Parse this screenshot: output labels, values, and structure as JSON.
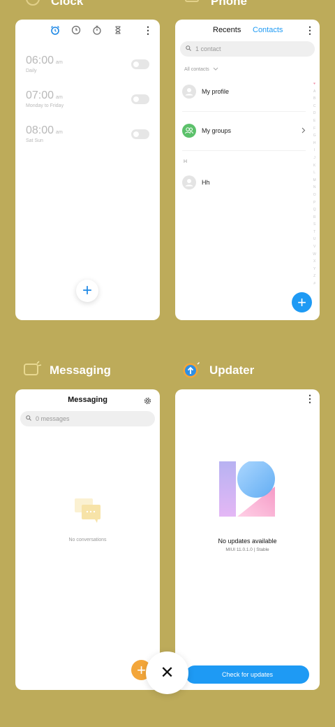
{
  "apps": {
    "clock": {
      "name": "Clock"
    },
    "phone": {
      "name": "Phone"
    },
    "messaging": {
      "name": "Messaging"
    },
    "updater": {
      "name": "Updater"
    }
  },
  "clock": {
    "alarms": [
      {
        "time": "06:00",
        "ampm": "am",
        "repeat": "Daily"
      },
      {
        "time": "07:00",
        "ampm": "am",
        "repeat": "Monday to Friday"
      },
      {
        "time": "08:00",
        "ampm": "am",
        "repeat": "Sat Sun"
      }
    ],
    "add": "+",
    "menu": "⋮",
    "accent": "#1e88e5"
  },
  "phone": {
    "tab_recents": "Recents",
    "tab_contacts": "Contacts",
    "menu": "⋮",
    "search_placeholder": "1 contact",
    "filter": "All contacts",
    "my_profile": "My profile",
    "my_groups": "My groups",
    "section_h": "H",
    "contact_hh": "Hh",
    "add": "+",
    "index_letters": [
      "♥",
      "A",
      "B",
      "C",
      "D",
      "E",
      "F",
      "G",
      "H",
      "I",
      "J",
      "K",
      "L",
      "M",
      "N",
      "O",
      "P",
      "Q",
      "R",
      "S",
      "T",
      "U",
      "V",
      "W",
      "X",
      "Y",
      "Z",
      "#"
    ]
  },
  "messaging": {
    "title": "Messaging",
    "search_placeholder": "0 messages",
    "empty": "No conversations",
    "add": "+"
  },
  "updater": {
    "menu": "⋮",
    "status": "No updates available",
    "version": "MIUI 11.0.1.0 | Stable",
    "check_button": "Check for updates"
  },
  "close": "✕"
}
